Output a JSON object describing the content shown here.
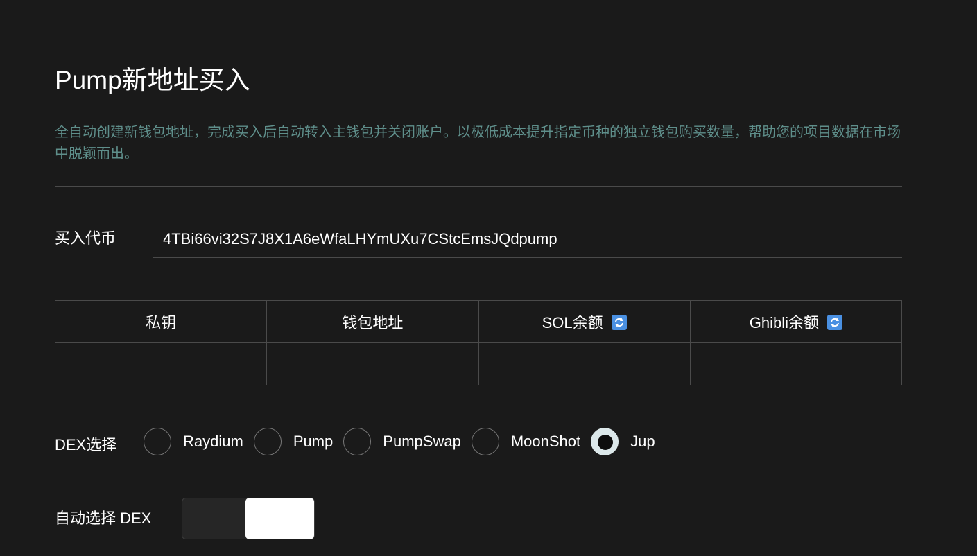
{
  "page": {
    "title": "Pump新地址买入",
    "description": "全自动创建新钱包地址，完成买入后自动转入主钱包并关闭账户。以极低成本提升指定币种的独立钱包购买数量，帮助您的项目数据在市场中脱颖而出。"
  },
  "token": {
    "label": "买入代币",
    "value": "4TBi66vi32S7J8X1A6eWfaLHYmUXu7CStcEmsJQdpump"
  },
  "table": {
    "headers": [
      "私钥",
      "钱包地址",
      "SOL余额",
      "Ghibli余额"
    ],
    "rows": [
      [
        "",
        "",
        "",
        ""
      ]
    ]
  },
  "dex": {
    "label": "DEX选择",
    "options": [
      "Raydium",
      "Pump",
      "PumpSwap",
      "MoonShot",
      "Jup"
    ],
    "selected": "Jup"
  },
  "auto_dex": {
    "label": "自动选择 DEX",
    "enabled": true
  },
  "colors": {
    "background": "#1a1a1a",
    "description": "#5f8f8b",
    "refresh_icon": "#4a90e2"
  }
}
